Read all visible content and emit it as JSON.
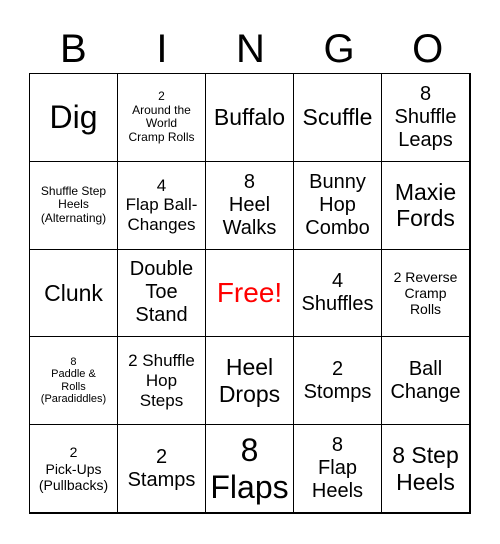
{
  "header": [
    "B",
    "I",
    "N",
    "G",
    "O"
  ],
  "free_color": "#ff0000",
  "cells": [
    {
      "text": "Dig",
      "size": "s-xl"
    },
    {
      "text": "2\nAround the\nWorld\nCramp Rolls",
      "size": "s-xs"
    },
    {
      "text": "Buffalo",
      "size": "s-l"
    },
    {
      "text": "Scuffle",
      "size": "s-l"
    },
    {
      "text": "8\nShuffle\nLeaps",
      "size": "s-ml"
    },
    {
      "text": "Shuffle Step\nHeels\n(Alternating)",
      "size": "s-xs"
    },
    {
      "text": "4\nFlap Ball-\nChanges",
      "size": "s-m"
    },
    {
      "text": "8\nHeel\nWalks",
      "size": "s-ml"
    },
    {
      "text": "Bunny\nHop\nCombo",
      "size": "s-ml"
    },
    {
      "text": "Maxie\nFords",
      "size": "s-l"
    },
    {
      "text": "Clunk",
      "size": "s-l"
    },
    {
      "text": "Double\nToe\nStand",
      "size": "s-ml"
    },
    {
      "text": "Free!",
      "size": "free",
      "free": true
    },
    {
      "text": "4\nShuffles",
      "size": "s-ml"
    },
    {
      "text": "2 Reverse\nCramp\nRolls",
      "size": "s-s"
    },
    {
      "text": "8\nPaddle &\nRolls\n(Paradiddles)",
      "size": "s-xxs"
    },
    {
      "text": "2 Shuffle\nHop\nSteps",
      "size": "s-m"
    },
    {
      "text": "Heel\nDrops",
      "size": "s-l"
    },
    {
      "text": "2\nStomps",
      "size": "s-ml"
    },
    {
      "text": "Ball\nChange",
      "size": "s-ml"
    },
    {
      "text": "2\nPick-Ups\n(Pullbacks)",
      "size": "s-s"
    },
    {
      "text": "2\nStamps",
      "size": "s-ml"
    },
    {
      "text": "8\nFlaps",
      "size": "s-xl"
    },
    {
      "text": "8\nFlap\nHeels",
      "size": "s-ml"
    },
    {
      "text": "8 Step\nHeels",
      "size": "s-l"
    }
  ]
}
